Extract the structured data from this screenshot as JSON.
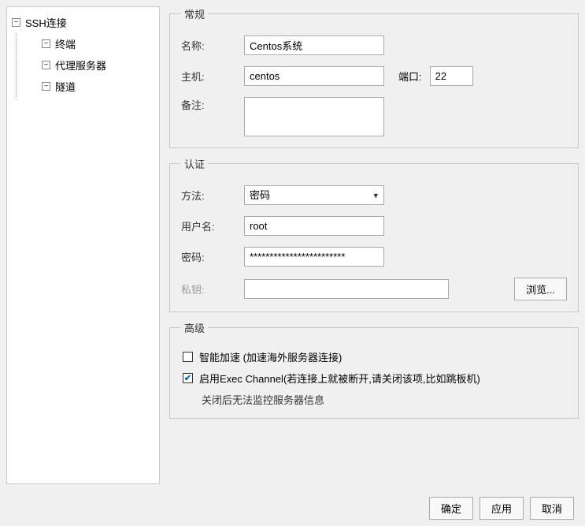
{
  "tree": {
    "root": "SSH连接",
    "children": [
      "终端",
      "代理服务器",
      "隧道"
    ]
  },
  "general": {
    "legend": "常规",
    "name_label": "名称:",
    "name_value": "Centos系统",
    "host_label": "主机:",
    "host_value": "centos",
    "port_label": "端口:",
    "port_value": "22",
    "remark_label": "备注:",
    "remark_value": ""
  },
  "auth": {
    "legend": "认证",
    "method_label": "方法:",
    "method_value": "密码",
    "user_label": "用户名:",
    "user_value": "root",
    "pass_label": "密码:",
    "pass_value": "************************",
    "key_label": "私钥:",
    "key_value": "",
    "browse_label": "浏览..."
  },
  "advanced": {
    "legend": "高级",
    "accel_label": "智能加速 (加速海外服务器连接)",
    "exec_label": "启用Exec Channel(若连接上就被断开,请关闭该项,比如跳板机)",
    "exec_note": "关闭后无法监控服务器信息"
  },
  "buttons": {
    "ok": "确定",
    "apply": "应用",
    "cancel": "取消"
  }
}
